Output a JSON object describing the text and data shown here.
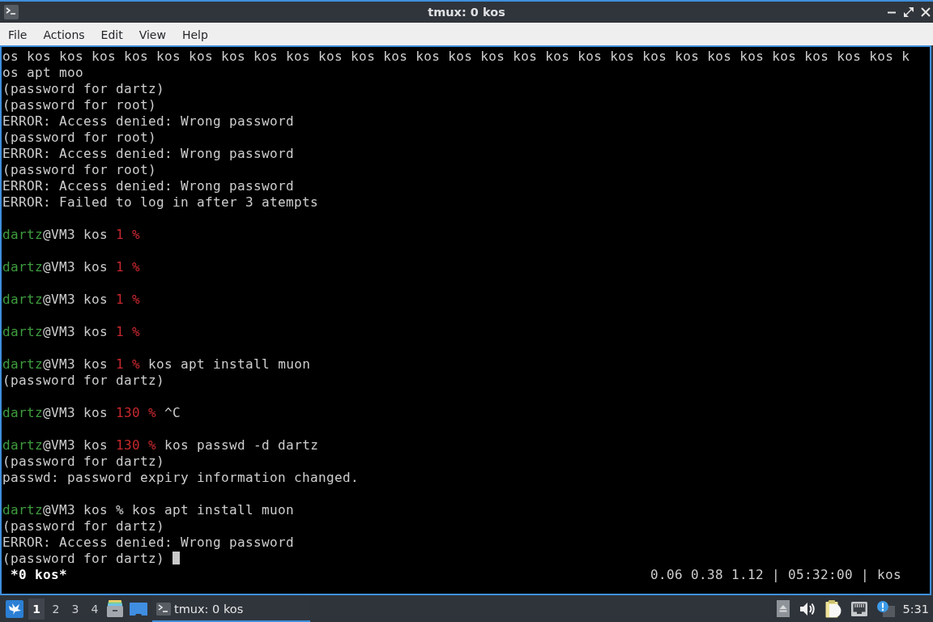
{
  "window": {
    "title": "tmux: 0 kos"
  },
  "menu": [
    {
      "label": "File"
    },
    {
      "label": "Actions"
    },
    {
      "label": "Edit"
    },
    {
      "label": "View"
    },
    {
      "label": "Help"
    }
  ],
  "terminal": {
    "lines": [
      {
        "kind": "output",
        "text": "os kos kos kos kos kos kos kos kos kos kos kos kos kos kos kos kos kos kos kos kos kos kos kos kos kos kos kos k"
      },
      {
        "kind": "output",
        "text": "os apt moo"
      },
      {
        "kind": "output",
        "text": "(password for dartz)"
      },
      {
        "kind": "output",
        "text": "(password for root)"
      },
      {
        "kind": "output",
        "text": "ERROR: Access denied: Wrong password"
      },
      {
        "kind": "output",
        "text": "(password for root)"
      },
      {
        "kind": "output",
        "text": "ERROR: Access denied: Wrong password"
      },
      {
        "kind": "output",
        "text": "(password for root)"
      },
      {
        "kind": "output",
        "text": "ERROR: Access denied: Wrong password"
      },
      {
        "kind": "output",
        "text": "ERROR: Failed to log in after 3 atempts"
      },
      {
        "kind": "blank"
      },
      {
        "kind": "prompt",
        "user": "dartz",
        "location": "@VM3 kos",
        "exit_code": "1",
        "symbol": "%"
      },
      {
        "kind": "blank"
      },
      {
        "kind": "prompt",
        "user": "dartz",
        "location": "@VM3 kos",
        "exit_code": "1",
        "symbol": "%"
      },
      {
        "kind": "blank"
      },
      {
        "kind": "prompt",
        "user": "dartz",
        "location": "@VM3 kos",
        "exit_code": "1",
        "symbol": "%"
      },
      {
        "kind": "blank"
      },
      {
        "kind": "prompt",
        "user": "dartz",
        "location": "@VM3 kos",
        "exit_code": "1",
        "symbol": "%"
      },
      {
        "kind": "blank"
      },
      {
        "kind": "prompt",
        "user": "dartz",
        "location": "@VM3 kos",
        "exit_code": "1",
        "symbol": "%",
        "command": "kos apt install muon"
      },
      {
        "kind": "output",
        "text": "(password for dartz)"
      },
      {
        "kind": "blank"
      },
      {
        "kind": "prompt",
        "user": "dartz",
        "location": "@VM3 kos",
        "exit_code": "130",
        "symbol": "%",
        "command": "^C"
      },
      {
        "kind": "blank"
      },
      {
        "kind": "prompt",
        "user": "dartz",
        "location": "@VM3 kos",
        "exit_code": "130",
        "symbol": "%",
        "command": "kos passwd -d dartz"
      },
      {
        "kind": "output",
        "text": "(password for dartz)"
      },
      {
        "kind": "output",
        "text": "passwd: password expiry information changed."
      },
      {
        "kind": "blank"
      },
      {
        "kind": "prompt",
        "user": "dartz",
        "location": "@VM3 kos",
        "symbol": "%",
        "command": "kos apt install muon"
      },
      {
        "kind": "output",
        "text": "(password for dartz)"
      },
      {
        "kind": "output",
        "text": "ERROR: Access denied: Wrong password"
      },
      {
        "kind": "input",
        "text": "(password for dartz)"
      }
    ],
    "status_bar": {
      "window_list": "*0 kos*",
      "status_right": "0.06 0.38 1.12 | 05:32:00 | kos"
    }
  },
  "taskbar": {
    "workspaces": [
      {
        "label": "1",
        "selected": true
      },
      {
        "label": "2",
        "selected": false
      },
      {
        "label": "3",
        "selected": false
      },
      {
        "label": "4",
        "selected": false
      }
    ],
    "tasks": [
      {
        "label": "tmux: 0 kos",
        "selected": true
      }
    ],
    "clock": "5:31"
  }
}
